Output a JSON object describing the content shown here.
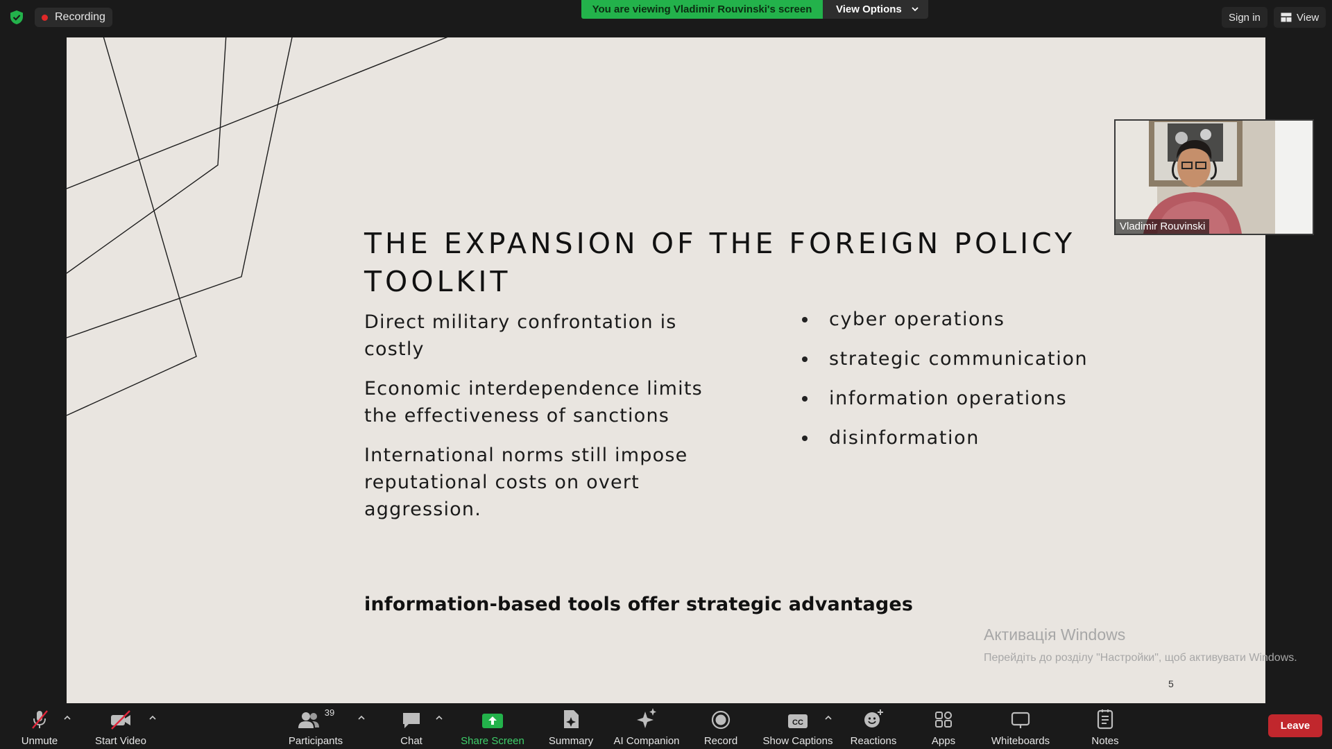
{
  "top_bar": {
    "recording_label": "Recording",
    "viewing_banner": "You are viewing Vladimir Rouvinski's screen",
    "view_options_label": "View Options",
    "sign_in_label": "Sign in",
    "view_label": "View"
  },
  "slide": {
    "title": "THE EXPANSION OF THE FOREIGN POLICY TOOLKIT",
    "left_points": [
      "Direct military confrontation is costly",
      "Economic interdependence limits the effectiveness of sanctions",
      "International norms still impose reputational costs on overt aggression."
    ],
    "bullets": [
      "cyber operations",
      "strategic communication",
      "information operations",
      "disinformation"
    ],
    "conclusion": "information-based tools offer strategic advantages",
    "page_number": "5"
  },
  "watermark": {
    "title": "Активація Windows",
    "subtitle": "Перейдіть до розділу \"Настройки\", щоб активувати Windows."
  },
  "video": {
    "participant_name": "Vladimir Rouvinski"
  },
  "toolbar": {
    "unmute": "Unmute",
    "start_video": "Start Video",
    "participants": "Participants",
    "participants_count": "39",
    "chat": "Chat",
    "share_screen": "Share Screen",
    "summary": "Summary",
    "ai_companion": "AI Companion",
    "record": "Record",
    "show_captions": "Show Captions",
    "reactions": "Reactions",
    "apps": "Apps",
    "whiteboards": "Whiteboards",
    "notes": "Notes",
    "leave": "Leave"
  },
  "colors": {
    "share_green": "#23b24b",
    "leave_red": "#c1272d",
    "recording_dot": "#e02828",
    "slide_bg": "#e9e5e0"
  }
}
